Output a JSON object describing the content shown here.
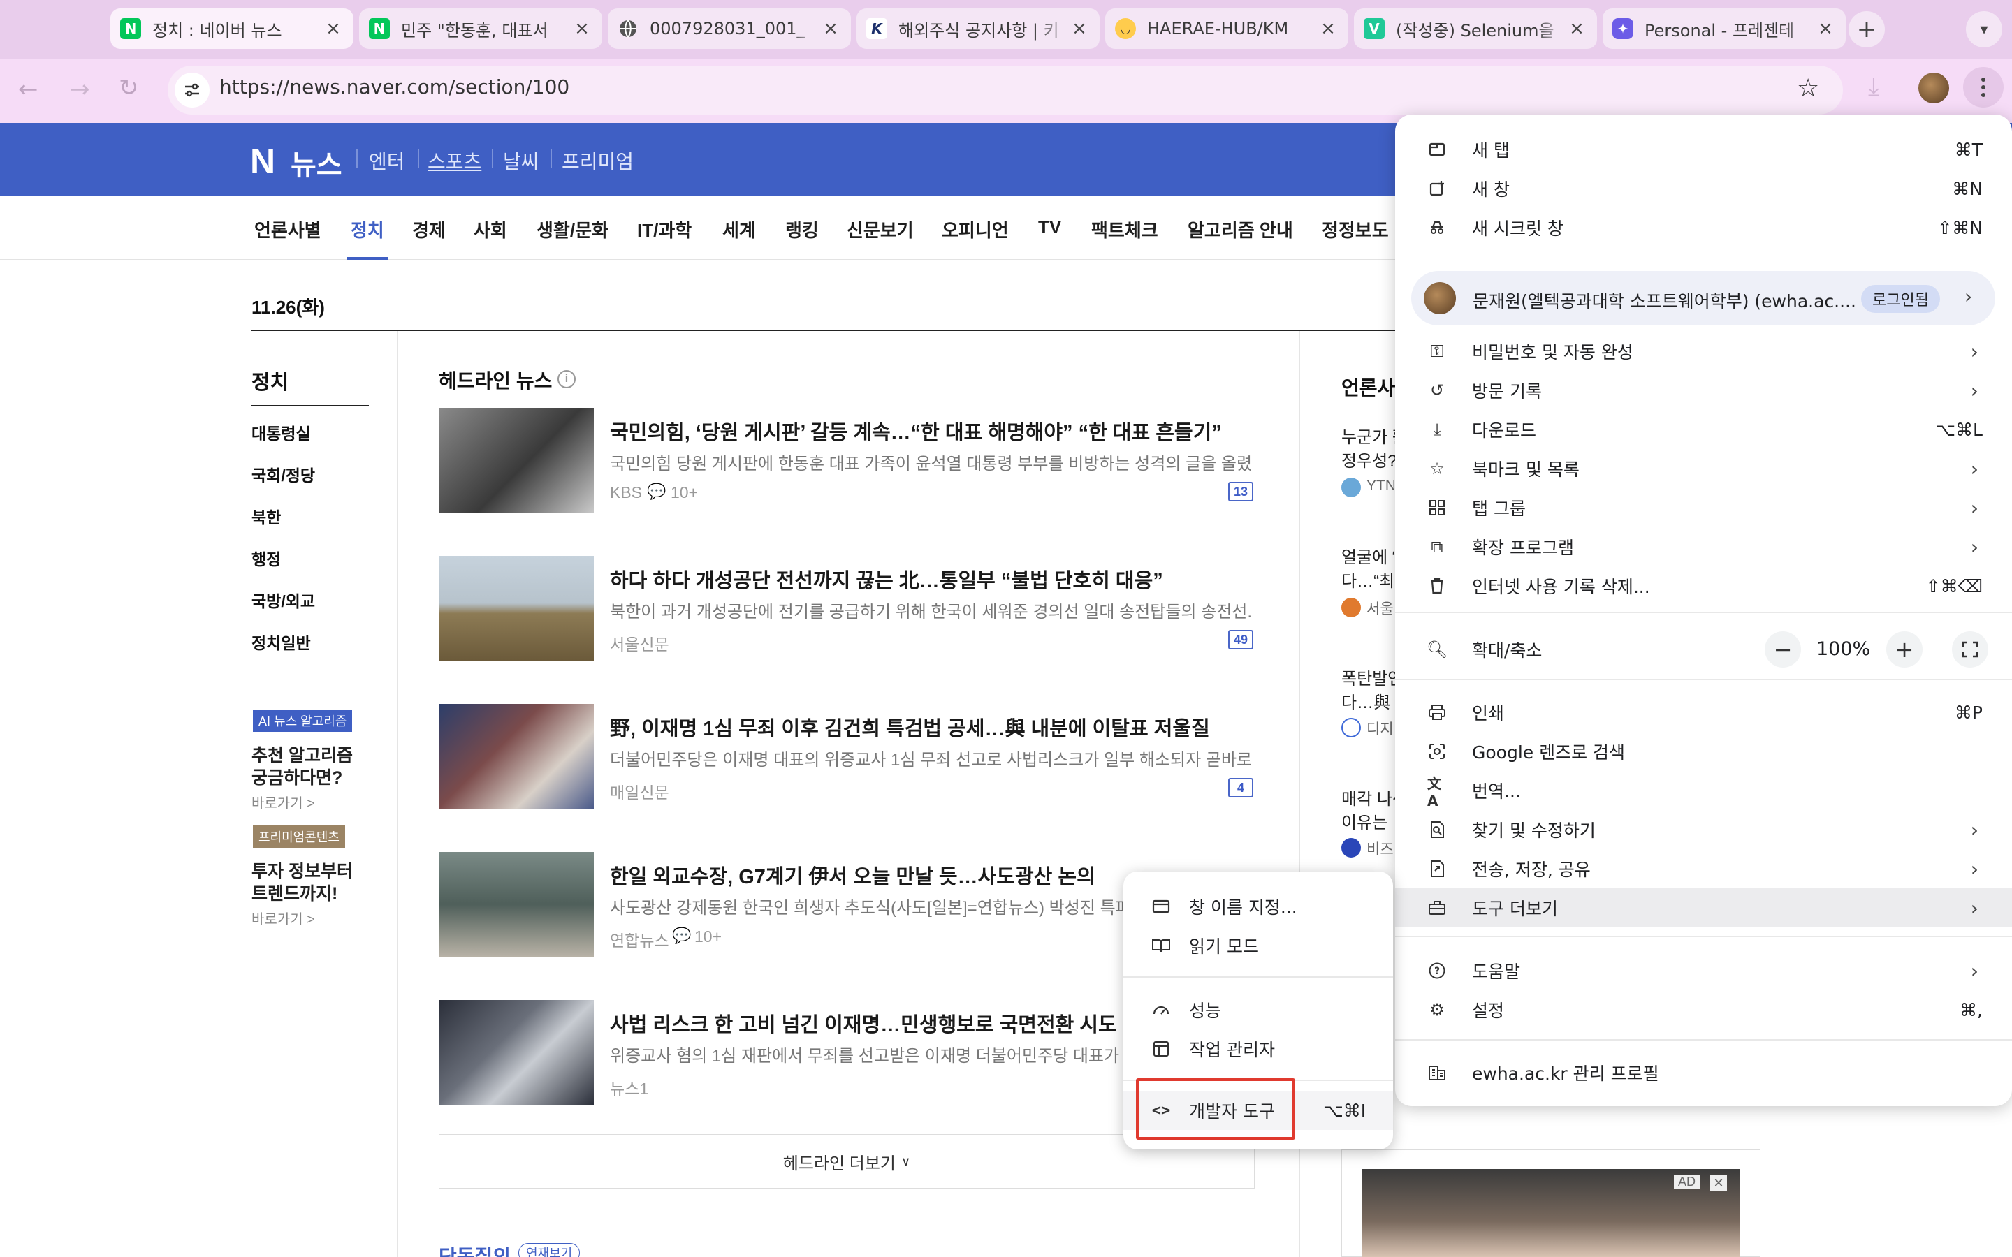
{
  "browser": {
    "tabs": [
      {
        "title": "정치 : 네이버 뉴스",
        "favicon": "N",
        "color": "#03c75a",
        "active": true
      },
      {
        "title": "민주 \"한동훈, 대표서",
        "favicon": "N",
        "color": "#03c75a"
      },
      {
        "title": "0007928031_001_",
        "favicon": "globe-icon",
        "color": "#555555"
      },
      {
        "title": "해외주식 공지사항 | 키",
        "favicon": "K",
        "color": "#1c2f6b"
      },
      {
        "title": "HAERAE-HUB/KM",
        "favicon": "hugging-face",
        "color": "#ffcc4d"
      },
      {
        "title": "(작성중) Selenium을",
        "favicon": "V",
        "color": "#20c997"
      },
      {
        "title": "Personal - 프레젠테",
        "favicon": "chat-icon",
        "color": "#6c5ce7"
      }
    ],
    "url": "https://news.naver.com/section/100"
  },
  "naver": {
    "logo": "N",
    "brand": "뉴스",
    "top_links": [
      "엔터",
      "스포츠",
      "날씨",
      "프리미엄"
    ],
    "nav": [
      "언론사별",
      "정치",
      "경제",
      "사회",
      "생활/문화",
      "IT/과학",
      "세계",
      "랭킹",
      "신문보기",
      "오피니언",
      "TV",
      "팩트체크",
      "알고리즘 안내",
      "정정보도"
    ],
    "date": "11.26(화)",
    "section_title": "정치",
    "side_links": [
      "대통령실",
      "국회/정당",
      "북한",
      "행정",
      "국방/외교",
      "정치일반"
    ],
    "promo1": {
      "badge": "AI 뉴스 알고리즘",
      "line1": "추천 알고리즘",
      "line2": "궁금하다면?",
      "more": "바로가기 >"
    },
    "promo2": {
      "badge": "프리미엄콘텐츠",
      "line1": "투자 정보부터",
      "line2": "트렌드까지!",
      "more": "바로가기 >"
    },
    "headline_label": "헤드라인 뉴스",
    "articles": [
      {
        "title": "국민의힘, ‘당원 게시판’ 갈등 계속…“한 대표 해명해야” “한 대표 흔들기”",
        "summary": "국민의힘 당원 게시판에 한동훈 대표 가족이 윤석열 대통령 부부를 비방하는 성격의 글을 올렸...",
        "press": "KBS",
        "comments": "10+",
        "count": "13"
      },
      {
        "title": "하다 하다 개성공단 전선까지 끊는 北…통일부 “불법 단호히 대응”",
        "summary": "북한이 과거 개성공단에 전기를 공급하기 위해 한국이 세워준 경의선 일대 송전탑들의 송전선...",
        "press": "서울신문",
        "comments": "",
        "count": "49"
      },
      {
        "title": "野, 이재명 1심 무죄 이후 김건희 특검법 공세…與 내분에 이탈표 저울질",
        "summary": "더불어민주당은 이재명 대표의 위증교사 1심 무죄 선고로 사법리스크가 일부 해소되자 곧바로 '...",
        "press": "매일신문",
        "comments": "",
        "count": "4"
      },
      {
        "title": "한일 외교수장, G7계기 伊서 오늘 만날 듯…사도광산 논의",
        "summary": "사도광산 강제동원 한국인 희생자 추도식(사도[일본]=연합뉴스) 박성진 특파",
        "press": "연합뉴스",
        "comments": "10+",
        "count": ""
      },
      {
        "title": "사법 리스크 한 고비 넘긴 이재명…민생행보로 국면전환 시도",
        "summary": "위증교사 혐의 1심 재판에서 무죄를 선고받은 이재명 더불어민주당 대표가 26",
        "press": "뉴스1",
        "comments": "",
        "count": ""
      }
    ],
    "more_headlines": "헤드라인 더보기",
    "right_col": {
      "title": "언론사",
      "items": [
        {
          "l1": "누군가 활",
          "l2": "정우성?",
          "press": "YTN"
        },
        {
          "l1": "얼굴에 “",
          "l2": "다…“최",
          "press": "서울"
        },
        {
          "l1": "폭탄발언",
          "l2": "다…與",
          "press": "디지"
        },
        {
          "l1": "매각 나선",
          "l2": "이유는",
          "press": "비즈"
        }
      ]
    },
    "bottom_title": "단독질의",
    "bottom_badge": "연재보기",
    "ad_label": "AD"
  },
  "chrome_menu": {
    "group1": [
      {
        "icon": "new-tab-icon",
        "label": "새 탭",
        "shortcut": "⌘T"
      },
      {
        "icon": "new-window-icon",
        "label": "새 창",
        "shortcut": "⌘N"
      },
      {
        "icon": "incognito-icon",
        "label": "새 시크릿 창",
        "shortcut": "⇧⌘N"
      }
    ],
    "profile": {
      "name": "문재원(엘텍공과대학 소프트웨어학부) (ewha.ac....",
      "status": "로그인됨"
    },
    "group2": [
      {
        "icon": "key-icon",
        "label": "비밀번호 및 자동 완성",
        "shortcut": ""
      },
      {
        "icon": "history-icon",
        "label": "방문 기록",
        "shortcut": ""
      },
      {
        "icon": "download-icon",
        "label": "다운로드",
        "shortcut": "⌥⌘L"
      },
      {
        "icon": "star-icon",
        "label": "북마크 및 목록",
        "shortcut": ""
      },
      {
        "icon": "tab-groups-icon",
        "label": "탭 그룹",
        "shortcut": ""
      },
      {
        "icon": "extension-icon",
        "label": "확장 프로그램",
        "shortcut": ""
      },
      {
        "icon": "trash-icon",
        "label": "인터넷 사용 기록 삭제...",
        "shortcut": "⇧⌘⌫"
      }
    ],
    "zoom": {
      "label": "확대/축소",
      "value": "100%"
    },
    "group3": [
      {
        "icon": "print-icon",
        "label": "인쇄",
        "shortcut": "⌘P"
      },
      {
        "icon": "lens-icon",
        "label": "Google 렌즈로 검색",
        "shortcut": ""
      },
      {
        "icon": "translate-icon",
        "label": "번역...",
        "shortcut": ""
      },
      {
        "icon": "find-icon",
        "label": "찾기 및 수정하기",
        "shortcut": ""
      },
      {
        "icon": "share-icon",
        "label": "전송, 저장, 공유",
        "shortcut": ""
      },
      {
        "icon": "toolbox-icon",
        "label": "도구 더보기",
        "shortcut": ""
      }
    ],
    "group4": [
      {
        "icon": "help-icon",
        "label": "도움말",
        "shortcut": ""
      },
      {
        "icon": "settings-icon",
        "label": "설정",
        "shortcut": "⌘,"
      }
    ],
    "managed": {
      "icon": "building-icon",
      "label": "ewha.ac.kr 관리 프로필"
    }
  },
  "submenu": {
    "items": [
      {
        "icon": "window-name-icon",
        "label": "창 이름 지정..."
      },
      {
        "icon": "reading-mode-icon",
        "label": "읽기 모드"
      },
      {
        "icon": "performance-icon",
        "label": "성능"
      },
      {
        "icon": "task-manager-icon",
        "label": "작업 관리자"
      }
    ],
    "devtools": {
      "label": "개발자 도구",
      "shortcut": "⌥⌘I"
    }
  },
  "colors": {
    "naver_header": "#3f5fc4",
    "tab_strip": "#e9cdec",
    "highlight": "#e03a2f"
  }
}
